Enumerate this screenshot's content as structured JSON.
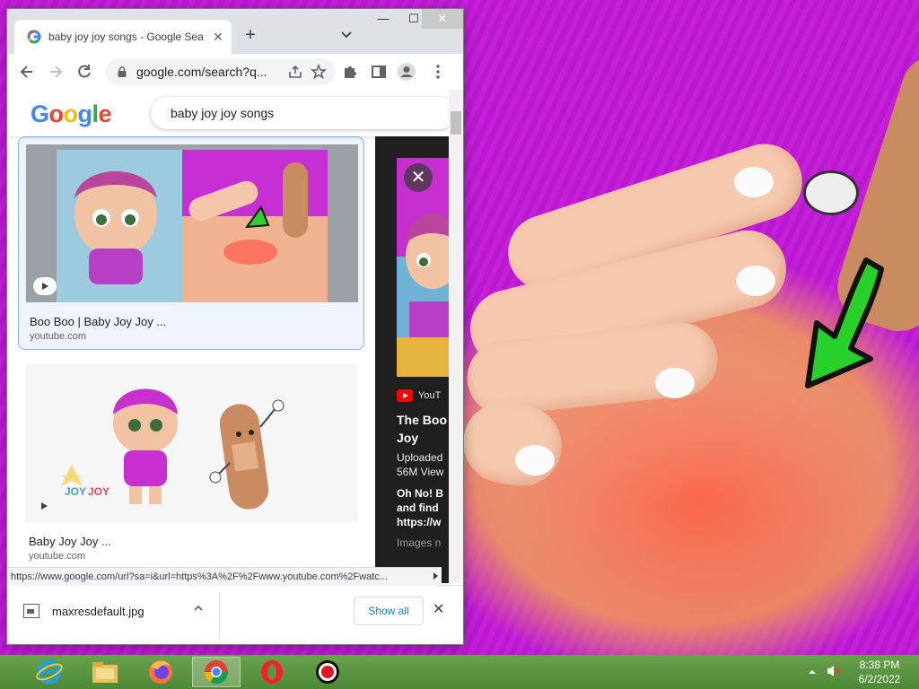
{
  "browser": {
    "tab_title": "baby joy joy songs - Google Sea",
    "tab_close": "✕",
    "new_tab": "+",
    "url": "google.com/search?q...",
    "window_min": "—",
    "window_max": "☐",
    "window_close": "✕"
  },
  "google": {
    "logo": [
      "G",
      "o",
      "o",
      "g",
      "l",
      "e"
    ],
    "logo_colors": [
      "#4285f4",
      "#ea4335",
      "#fbbc05",
      "#4285f4",
      "#34a853",
      "#ea4335"
    ],
    "query": "baby joy joy songs"
  },
  "results": [
    {
      "title": "Boo Boo | Baby Joy Joy ...",
      "site": "youtube.com",
      "selected": true
    },
    {
      "title": "Baby Joy Joy ...",
      "site": "youtube.com",
      "selected": false
    }
  ],
  "preview": {
    "close": "✕",
    "source": "YouT",
    "title_line1": "The Boo",
    "title_line2": "Joy",
    "meta_line1": "Uploaded",
    "meta_line2": "56M View",
    "desc_line1": "Oh No! B",
    "desc_line2": "and find",
    "desc_line3": "https://w",
    "images_label": "Images n"
  },
  "status_url": "https://www.google.com/url?sa=i&url=https%3A%2F%2Fwww.youtube.com%2Fwatc...",
  "downloads": {
    "file_name": "maxresdefault.jpg",
    "show_all": "Show all",
    "close": "✕"
  },
  "taskbar": {
    "apps": [
      "internet-explorer-icon",
      "file-explorer-icon",
      "firefox-icon",
      "chrome-icon",
      "opera-icon",
      "screen-recorder-icon"
    ],
    "active_app": "chrome-icon",
    "time": "8:38 PM",
    "date": "6/2/2022"
  },
  "colors": {
    "wallpaper": "#c11ed8",
    "taskbar": "#5a9640",
    "accent": "#1a73e8"
  }
}
